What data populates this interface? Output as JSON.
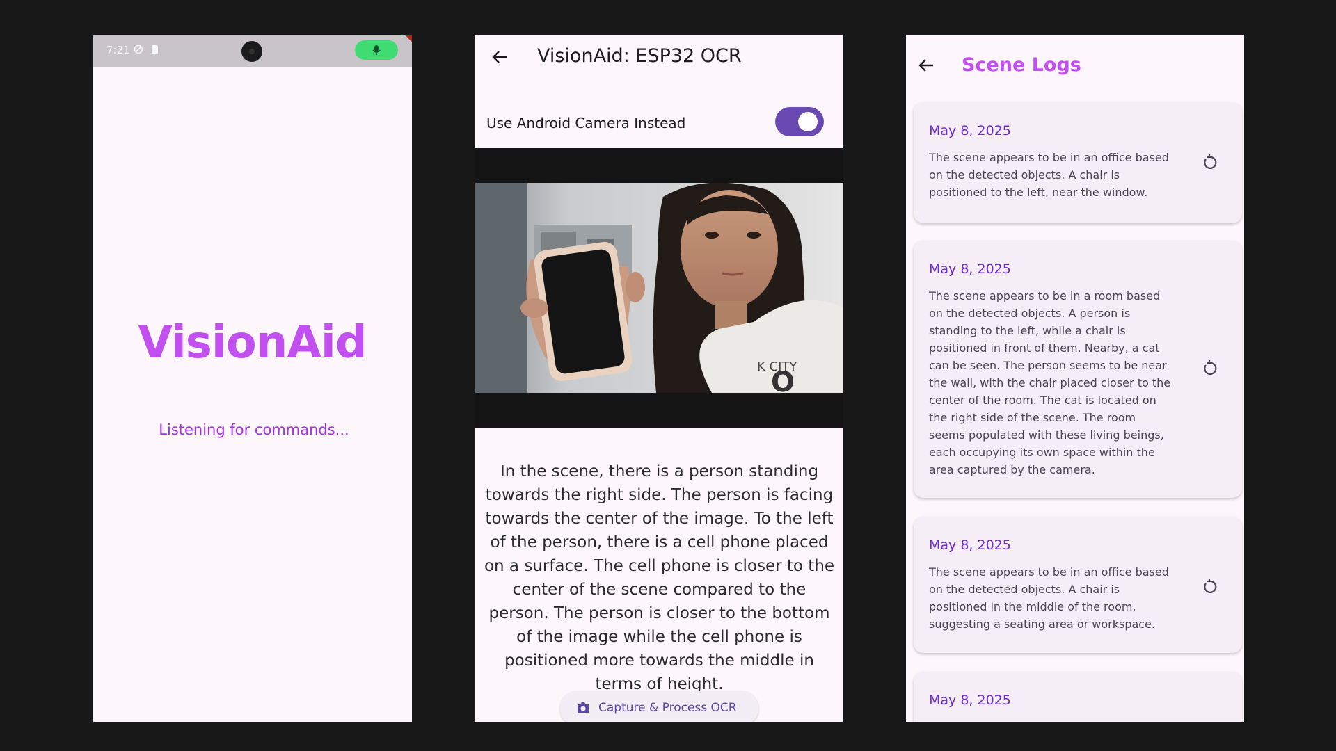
{
  "screen1": {
    "status_time": "7:21",
    "brand": "VisionAid",
    "status_message": "Listening for commands..."
  },
  "screen2": {
    "title": "VisionAid: ESP32 OCR",
    "toggle_label": "Use Android Camera Instead",
    "toggle_on": true,
    "description": "In the scene, there is a person standing towards the right side. The person is facing towards the center of the image. To the left of the person, there is a cell phone placed on a surface. The cell phone is closer to the center of the scene compared to the person. The person is closer to the bottom of the image while the cell phone is positioned more towards the middle in terms of height.",
    "capture_button": "Capture & Process OCR",
    "shirt_text": "K CITY",
    "shirt_text2": "O"
  },
  "screen3": {
    "title": "Scene Logs",
    "logs": [
      {
        "date": "May 8, 2025",
        "text": "The scene appears to be in an office based on the detected objects. A chair is positioned to the left, near the window."
      },
      {
        "date": "May 8, 2025",
        "text": "The scene appears to be in a room based on the detected objects. A person is standing to the left, while a chair is positioned in front of them. Nearby, a cat can be seen. The person seems to be near the wall, with the chair placed closer to the center of the room. The cat is located on the right side of the scene. The room seems populated with these living beings, each occupying its own space within the area captured by the camera."
      },
      {
        "date": "May 8, 2025",
        "text": "The scene appears to be in an office based on the detected objects. A chair is positioned in the middle of the room, suggesting a seating area or workspace."
      },
      {
        "date": "May 8, 2025",
        "text": ""
      }
    ]
  },
  "colors": {
    "background": "#181818",
    "screen_bg": "#fdf7fc",
    "brand_purple": "#c24ff0",
    "deep_purple": "#6a4ab2",
    "date_purple": "#6d2ad0"
  }
}
